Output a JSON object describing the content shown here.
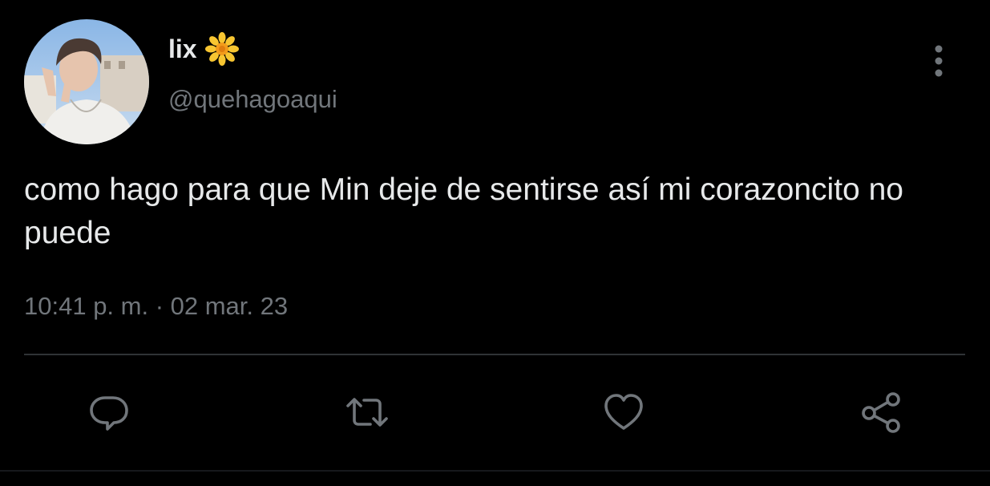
{
  "user": {
    "display_name": "lix",
    "display_emoji": "sunflower-emoji",
    "handle": "@quehagoaqui",
    "avatar": "avatar-photo"
  },
  "tweet": {
    "text": "como hago para que Min deje de sentirse así mi corazoncito no puede",
    "timestamp": "10:41 p. m. · 02 mar. 23"
  },
  "actions": {
    "reply_icon": "reply-icon",
    "retweet_icon": "retweet-icon",
    "like_icon": "heart-icon",
    "share_icon": "share-icon",
    "more_icon": "more-vertical-icon"
  },
  "colors": {
    "background": "#000000",
    "text": "#e7e9ea",
    "secondary_text": "#71767b",
    "icon": "#71767b"
  }
}
